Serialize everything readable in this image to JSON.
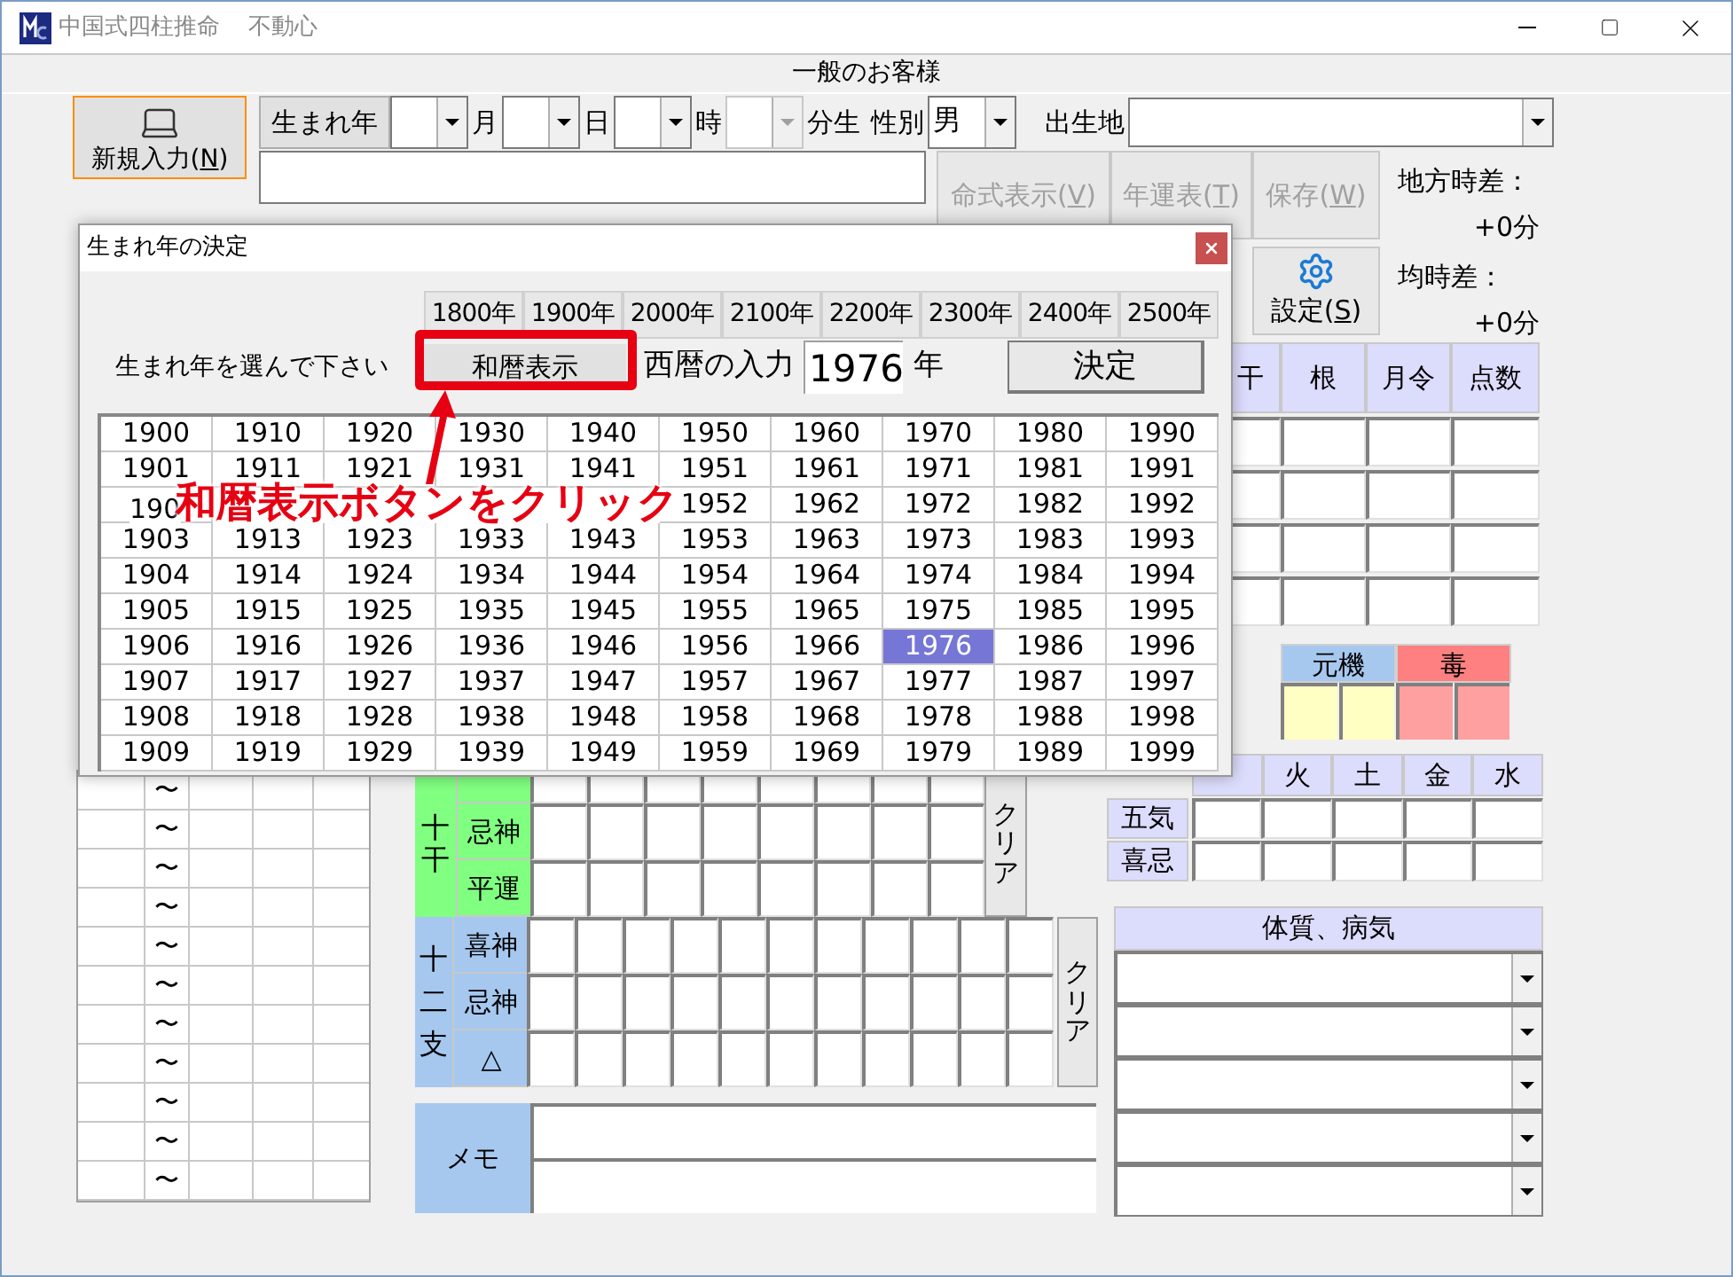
{
  "window": {
    "title": "中国式四柱推命",
    "subtitle": "不動心"
  },
  "header": "一般のお客様",
  "new_button": {
    "before": "新規入力(",
    "key": "N",
    "after": ")"
  },
  "birth_year_button": "生まれ年",
  "date_fields": [
    {
      "unit": "月",
      "disabled": false
    },
    {
      "unit": "日",
      "disabled": false
    },
    {
      "unit": "時",
      "disabled": false
    },
    {
      "unit": "分生",
      "disabled": true
    }
  ],
  "gender": {
    "label": "性別",
    "value": "男"
  },
  "birthplace": {
    "label": "出生地"
  },
  "actions": [
    {
      "before": "命式表示(",
      "key": "V",
      "after": ")",
      "disabled": true
    },
    {
      "before": "年運表(",
      "key": "T",
      "after": ")",
      "disabled": true
    },
    {
      "before": "保存(",
      "key": "W",
      "after": ")",
      "disabled": true
    }
  ],
  "settings_button": {
    "before": "設定(",
    "key": "S",
    "after": ")"
  },
  "time_diffs": [
    {
      "label": "地方時差：",
      "value": "+0分"
    },
    {
      "label": "均時差：",
      "value": "+0分"
    }
  ],
  "score_table": {
    "columns": [
      "干",
      "根",
      "月令",
      "点数"
    ]
  },
  "genki": [
    {
      "label": "元機",
      "color": "#a6c8ef"
    },
    {
      "label": "毒",
      "color": "#ff8080"
    }
  ],
  "gogyo": {
    "columns": [
      "火",
      "土",
      "金",
      "水"
    ],
    "rows": [
      "五気",
      "喜忌"
    ]
  },
  "constitution": {
    "title": "体質、病気"
  },
  "left_table": {
    "rows": [
      "〜",
      "〜",
      "〜",
      "〜",
      "〜",
      "〜",
      "〜",
      "〜",
      "〜",
      "〜",
      "〜"
    ]
  },
  "jikkan": {
    "label": "十干",
    "rows": [
      "忌神",
      "平運"
    ],
    "clear": "クリア"
  },
  "junishi": {
    "label": "十二支",
    "rows": [
      "喜神",
      "忌神",
      "△"
    ],
    "clear": "クリア"
  },
  "memo": {
    "label": "メモ"
  },
  "dialog": {
    "title": "生まれ年の決定",
    "centuries": [
      "1800年",
      "1900年",
      "2000年",
      "2100年",
      "2200年",
      "2300年",
      "2400年",
      "2500年"
    ],
    "prompt": "生まれ年を選んで下さい",
    "wareki_button": "和暦表示",
    "seireki_label": "西暦の入力",
    "year_value": "1976",
    "year_unit": "年",
    "decide_button": "決定",
    "years": [
      [
        {
          "kind": "year",
          "text": "1900",
          "selected": false
        },
        {
          "kind": "year",
          "text": "1910",
          "selected": false
        },
        {
          "kind": "year",
          "text": "1920",
          "selected": false
        },
        {
          "kind": "year",
          "text": "1930",
          "selected": false
        },
        {
          "kind": "year",
          "text": "1940",
          "selected": false
        },
        {
          "kind": "year",
          "text": "1950",
          "selected": false
        },
        {
          "kind": "year",
          "text": "1960",
          "selected": false
        },
        {
          "kind": "year",
          "text": "1970",
          "selected": false
        },
        {
          "kind": "year",
          "text": "1980",
          "selected": false
        },
        {
          "kind": "year",
          "text": "1990",
          "selected": false
        }
      ],
      [
        {
          "kind": "year",
          "text": "1901",
          "selected": false
        },
        {
          "kind": "year",
          "text": "1911",
          "selected": false
        },
        {
          "kind": "year",
          "text": "1921",
          "selected": false
        },
        {
          "kind": "year",
          "text": "1931",
          "selected": false
        },
        {
          "kind": "year",
          "text": "1941",
          "selected": false
        },
        {
          "kind": "year",
          "text": "1951",
          "selected": false
        },
        {
          "kind": "year",
          "text": "1961",
          "selected": false
        },
        {
          "kind": "year",
          "text": "1971",
          "selected": false
        },
        {
          "kind": "year",
          "text": "1981",
          "selected": false
        },
        {
          "kind": "year",
          "text": "1991",
          "selected": false
        }
      ],
      [
        {
          "kind": "partial",
          "text": "190",
          "selected": false
        },
        {
          "kind": "covered"
        },
        {
          "kind": "covered"
        },
        {
          "kind": "covered"
        },
        {
          "kind": "covered"
        },
        {
          "kind": "year",
          "text": "1952",
          "selected": false
        },
        {
          "kind": "year",
          "text": "1962",
          "selected": false
        },
        {
          "kind": "year",
          "text": "1972",
          "selected": false
        },
        {
          "kind": "year",
          "text": "1982",
          "selected": false
        },
        {
          "kind": "year",
          "text": "1992",
          "selected": false
        }
      ],
      [
        {
          "kind": "year",
          "text": "1903",
          "selected": false
        },
        {
          "kind": "year",
          "text": "1913",
          "selected": false
        },
        {
          "kind": "year",
          "text": "1923",
          "selected": false
        },
        {
          "kind": "year",
          "text": "1933",
          "selected": false
        },
        {
          "kind": "year",
          "text": "1943",
          "selected": false
        },
        {
          "kind": "year",
          "text": "1953",
          "selected": false
        },
        {
          "kind": "year",
          "text": "1963",
          "selected": false
        },
        {
          "kind": "year",
          "text": "1973",
          "selected": false
        },
        {
          "kind": "year",
          "text": "1983",
          "selected": false
        },
        {
          "kind": "year",
          "text": "1993",
          "selected": false
        }
      ],
      [
        {
          "kind": "year",
          "text": "1904",
          "selected": false
        },
        {
          "kind": "year",
          "text": "1914",
          "selected": false
        },
        {
          "kind": "year",
          "text": "1924",
          "selected": false
        },
        {
          "kind": "year",
          "text": "1934",
          "selected": false
        },
        {
          "kind": "year",
          "text": "1944",
          "selected": false
        },
        {
          "kind": "year",
          "text": "1954",
          "selected": false
        },
        {
          "kind": "year",
          "text": "1964",
          "selected": false
        },
        {
          "kind": "year",
          "text": "1974",
          "selected": false
        },
        {
          "kind": "year",
          "text": "1984",
          "selected": false
        },
        {
          "kind": "year",
          "text": "1994",
          "selected": false
        }
      ],
      [
        {
          "kind": "year",
          "text": "1905",
          "selected": false
        },
        {
          "kind": "year",
          "text": "1915",
          "selected": false
        },
        {
          "kind": "year",
          "text": "1925",
          "selected": false
        },
        {
          "kind": "year",
          "text": "1935",
          "selected": false
        },
        {
          "kind": "year",
          "text": "1945",
          "selected": false
        },
        {
          "kind": "year",
          "text": "1955",
          "selected": false
        },
        {
          "kind": "year",
          "text": "1965",
          "selected": false
        },
        {
          "kind": "year",
          "text": "1975",
          "selected": false
        },
        {
          "kind": "year",
          "text": "1985",
          "selected": false
        },
        {
          "kind": "year",
          "text": "1995",
          "selected": false
        }
      ],
      [
        {
          "kind": "year",
          "text": "1906",
          "selected": false
        },
        {
          "kind": "year",
          "text": "1916",
          "selected": false
        },
        {
          "kind": "year",
          "text": "1926",
          "selected": false
        },
        {
          "kind": "year",
          "text": "1936",
          "selected": false
        },
        {
          "kind": "year",
          "text": "1946",
          "selected": false
        },
        {
          "kind": "year",
          "text": "1956",
          "selected": false
        },
        {
          "kind": "year",
          "text": "1966",
          "selected": false
        },
        {
          "kind": "year",
          "text": "1976",
          "selected": true
        },
        {
          "kind": "year",
          "text": "1986",
          "selected": false
        },
        {
          "kind": "year",
          "text": "1996",
          "selected": false
        }
      ],
      [
        {
          "kind": "year",
          "text": "1907",
          "selected": false
        },
        {
          "kind": "year",
          "text": "1917",
          "selected": false
        },
        {
          "kind": "year",
          "text": "1927",
          "selected": false
        },
        {
          "kind": "year",
          "text": "1937",
          "selected": false
        },
        {
          "kind": "year",
          "text": "1947",
          "selected": false
        },
        {
          "kind": "year",
          "text": "1957",
          "selected": false
        },
        {
          "kind": "year",
          "text": "1967",
          "selected": false
        },
        {
          "kind": "year",
          "text": "1977",
          "selected": false
        },
        {
          "kind": "year",
          "text": "1987",
          "selected": false
        },
        {
          "kind": "year",
          "text": "1997",
          "selected": false
        }
      ],
      [
        {
          "kind": "year",
          "text": "1908",
          "selected": false
        },
        {
          "kind": "year",
          "text": "1918",
          "selected": false
        },
        {
          "kind": "year",
          "text": "1928",
          "selected": false
        },
        {
          "kind": "year",
          "text": "1938",
          "selected": false
        },
        {
          "kind": "year",
          "text": "1948",
          "selected": false
        },
        {
          "kind": "year",
          "text": "1958",
          "selected": false
        },
        {
          "kind": "year",
          "text": "1968",
          "selected": false
        },
        {
          "kind": "year",
          "text": "1978",
          "selected": false
        },
        {
          "kind": "year",
          "text": "1988",
          "selected": false
        },
        {
          "kind": "year",
          "text": "1998",
          "selected": false
        }
      ],
      [
        {
          "kind": "year",
          "text": "1909",
          "selected": false
        },
        {
          "kind": "year",
          "text": "1919",
          "selected": false
        },
        {
          "kind": "year",
          "text": "1929",
          "selected": false
        },
        {
          "kind": "year",
          "text": "1939",
          "selected": false
        },
        {
          "kind": "year",
          "text": "1949",
          "selected": false
        },
        {
          "kind": "year",
          "text": "1959",
          "selected": false
        },
        {
          "kind": "year",
          "text": "1969",
          "selected": false
        },
        {
          "kind": "year",
          "text": "1979",
          "selected": false
        },
        {
          "kind": "year",
          "text": "1989",
          "selected": false
        },
        {
          "kind": "year",
          "text": "1999",
          "selected": false
        }
      ]
    ]
  },
  "annotation": {
    "text": "和暦表示ボタンをクリック"
  }
}
